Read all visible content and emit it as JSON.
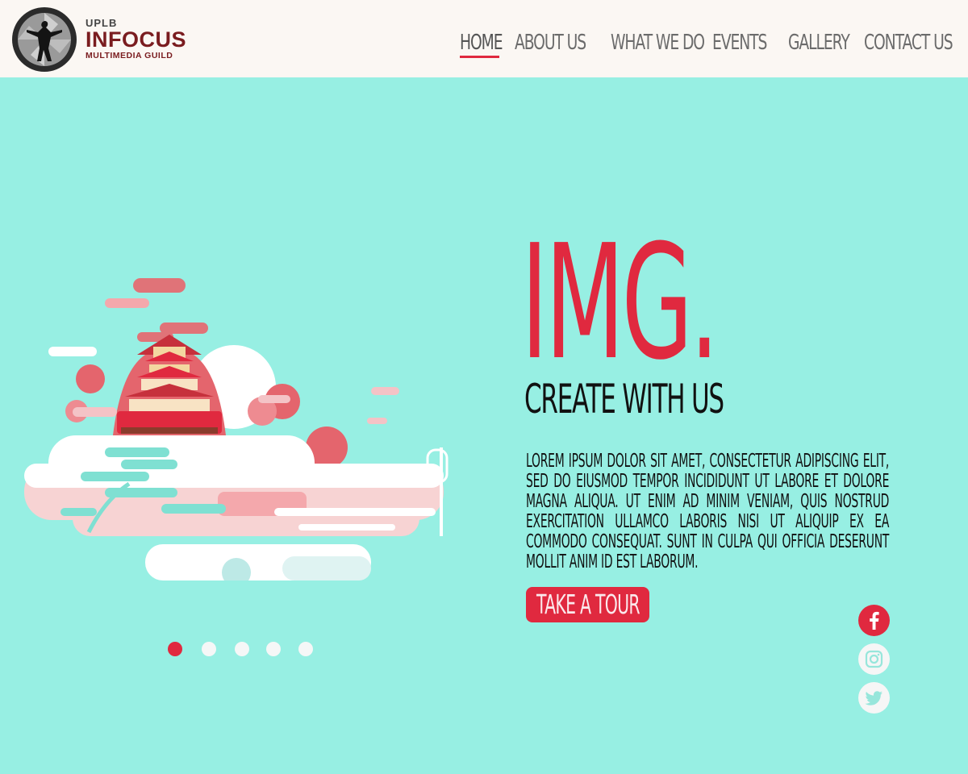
{
  "brand": {
    "small": "UPLB",
    "name": "INFOCUS",
    "tagline": "MULTIMEDIA GUILD"
  },
  "nav": {
    "items": [
      {
        "label": "HOME",
        "active": true
      },
      {
        "label": "ABOUT US"
      },
      {
        "label": "WHAT WE DO"
      },
      {
        "label": "EVENTS"
      },
      {
        "label": "GALLERY"
      },
      {
        "label": "CONTACT US"
      }
    ]
  },
  "hero": {
    "title": "IMG.",
    "subtitle": "CREATE WITH US",
    "body": "LOREM IPSUM DOLOR SIT AMET, CONSECTETUR ADIPISCING ELIT, SED DO EIUSMOD TEMPOR INCIDIDUNT UT LABORE ET DOLORE MAGNA ALIQUA. UT ENIM AD MINIM VENIAM, QUIS NOSTRUD EXERCITATION ULLAMCO LABORIS NISI UT ALIQUIP EX EA COMMODO CONSEQUAT. SUNT IN CULPA QUI OFFICIA DESERUNT MOLLIT ANIM ID EST LABORUM.",
    "cta_label": "TAKE A TOUR"
  },
  "slider": {
    "count": 5,
    "active_index": 1
  },
  "social": {
    "facebook_icon": "facebook-icon",
    "instagram_icon": "instagram-icon",
    "twitter_icon": "twitter-icon"
  },
  "colors": {
    "accent": "#e0293f",
    "background": "#97efe3",
    "header": "#fbf7f3",
    "brand": "#7a1c1f"
  }
}
